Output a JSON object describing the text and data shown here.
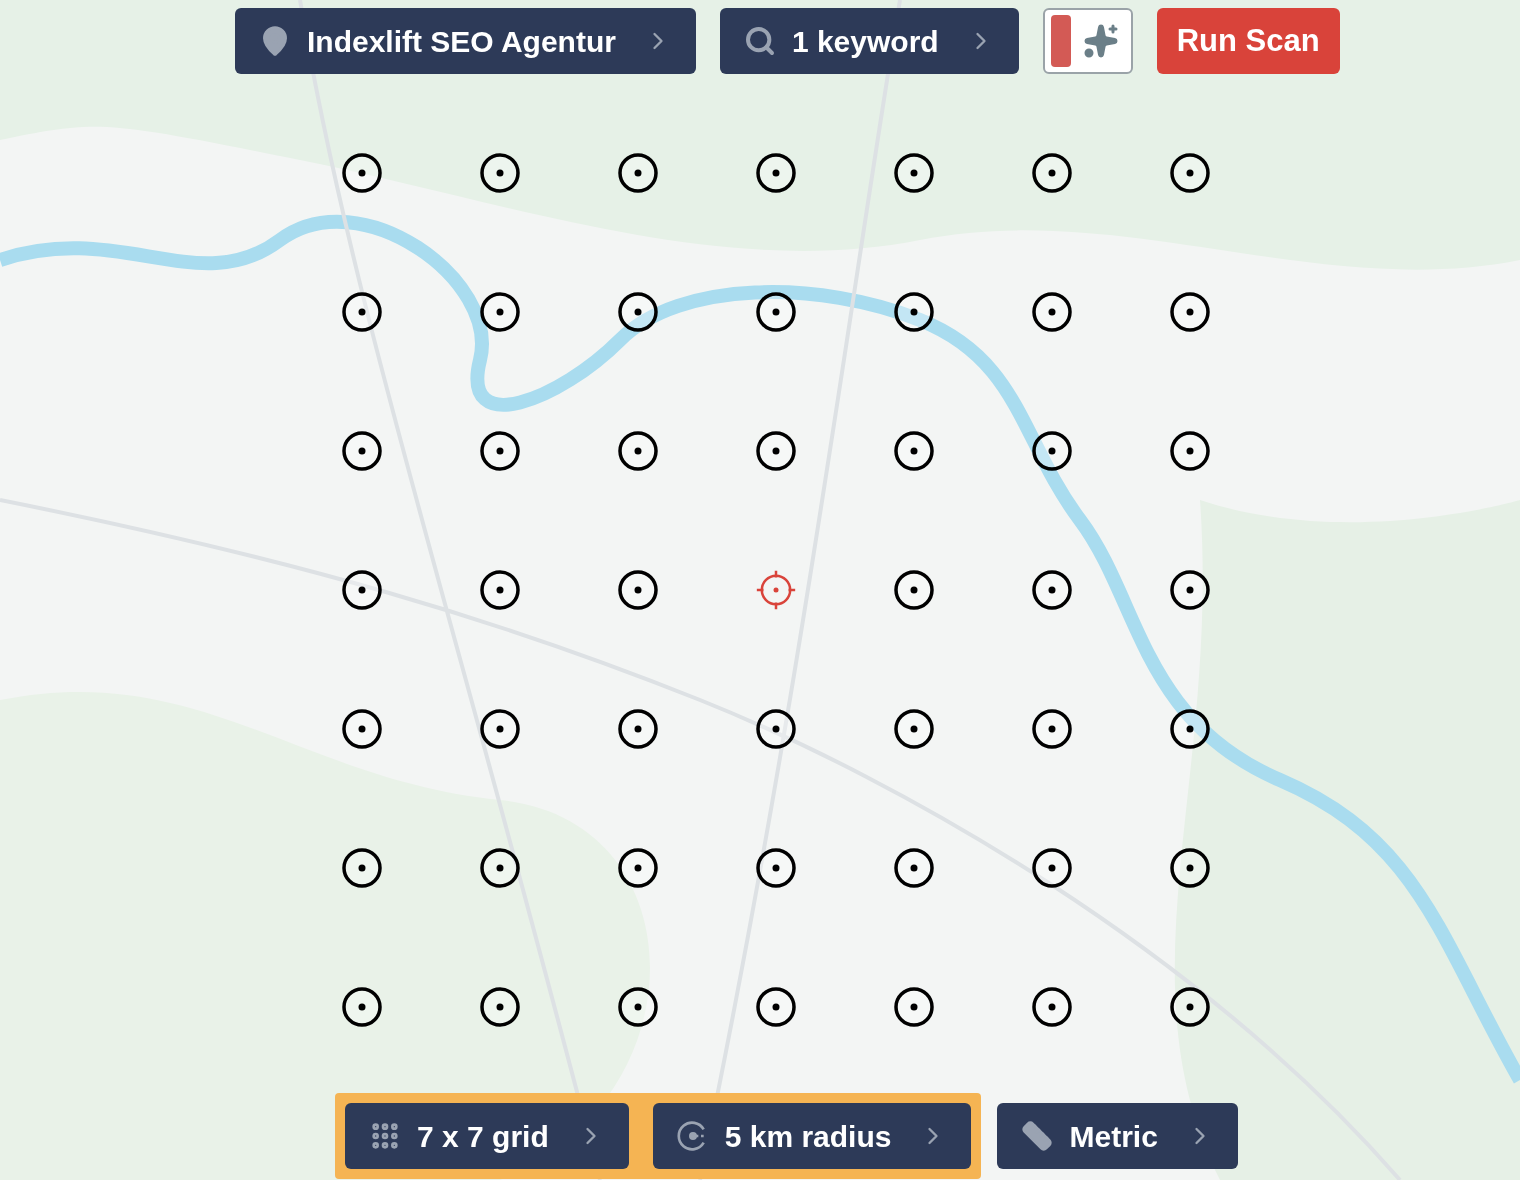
{
  "top_bar": [
    {
      "kind": "location",
      "label": "Indexlift SEO Agentur"
    },
    {
      "kind": "keyword",
      "label": "1 keyword"
    },
    {
      "kind": "style_toggle"
    },
    {
      "kind": "run",
      "label": "Run Scan"
    }
  ],
  "grid_points": [
    [
      {
        "selected": false
      },
      {
        "selected": false
      },
      {
        "selected": false
      },
      {
        "selected": false
      },
      {
        "selected": false
      },
      {
        "selected": false
      },
      {
        "selected": false
      }
    ],
    [
      {
        "selected": false
      },
      {
        "selected": false
      },
      {
        "selected": false
      },
      {
        "selected": false
      },
      {
        "selected": false
      },
      {
        "selected": false
      },
      {
        "selected": false
      }
    ],
    [
      {
        "selected": false
      },
      {
        "selected": false
      },
      {
        "selected": false
      },
      {
        "selected": false
      },
      {
        "selected": false
      },
      {
        "selected": false
      },
      {
        "selected": false
      }
    ],
    [
      {
        "selected": false
      },
      {
        "selected": false
      },
      {
        "selected": false
      },
      {
        "selected": true
      },
      {
        "selected": false
      },
      {
        "selected": false
      },
      {
        "selected": false
      }
    ],
    [
      {
        "selected": false
      },
      {
        "selected": false
      },
      {
        "selected": false
      },
      {
        "selected": false
      },
      {
        "selected": false
      },
      {
        "selected": false
      },
      {
        "selected": false
      }
    ],
    [
      {
        "selected": false
      },
      {
        "selected": false
      },
      {
        "selected": false
      },
      {
        "selected": false
      },
      {
        "selected": false
      },
      {
        "selected": false
      },
      {
        "selected": false
      }
    ],
    [
      {
        "selected": false
      },
      {
        "selected": false
      },
      {
        "selected": false
      },
      {
        "selected": false
      },
      {
        "selected": false
      },
      {
        "selected": false
      },
      {
        "selected": false
      }
    ]
  ],
  "bottom_bar": [
    {
      "kind": "grid",
      "label": "7 x 7 grid",
      "highlighted": true
    },
    {
      "kind": "radius",
      "label": "5 km radius",
      "highlighted": true
    },
    {
      "kind": "units",
      "label": "Metric",
      "highlighted": false
    }
  ]
}
